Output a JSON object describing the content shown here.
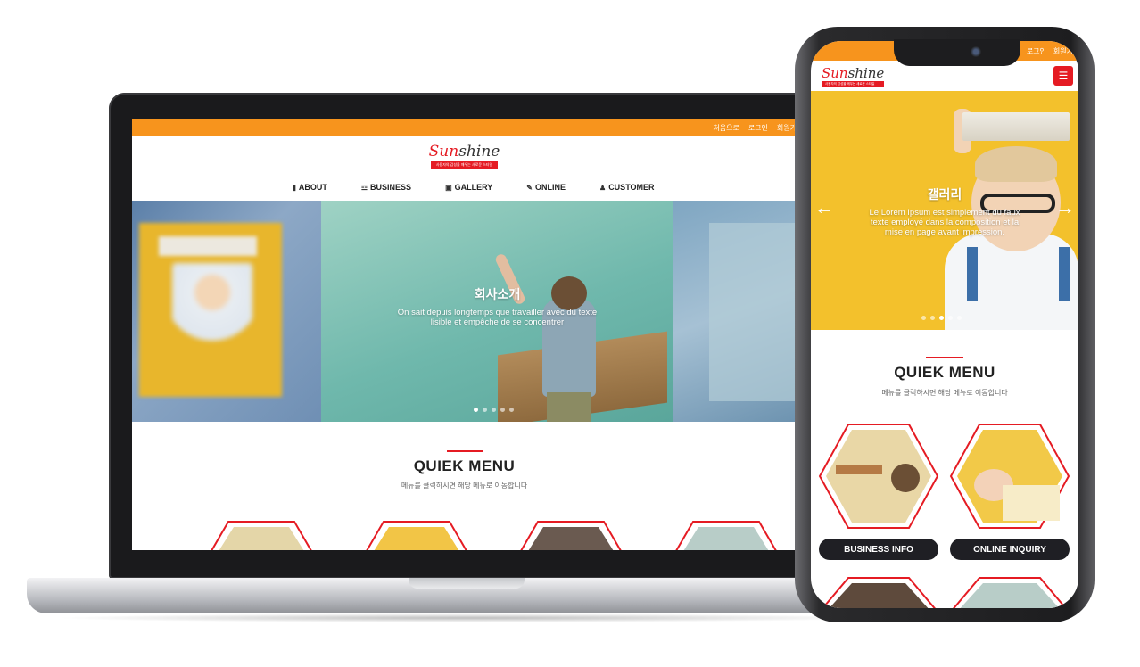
{
  "laptop": {
    "topbar": {
      "links": [
        "처음으로",
        "로그인",
        "회원가"
      ]
    },
    "logo": {
      "name_part1": "Sun",
      "name_part2": "shine",
      "tagline": "사용자의 감성을 깨우는 새로운 스타일"
    },
    "nav": [
      {
        "label": "ABOUT",
        "icon": "document-icon"
      },
      {
        "label": "BUSINESS",
        "icon": "sitemap-icon"
      },
      {
        "label": "GALLERY",
        "icon": "image-icon"
      },
      {
        "label": "ONLINE",
        "icon": "edit-icon"
      },
      {
        "label": "CUSTOMER",
        "icon": "users-icon"
      }
    ],
    "hero": {
      "title": "회사소개",
      "desc_line1": "On sait depuis longtemps que travailler avec du texte",
      "desc_line2": "lisible et empêche de se concentrer",
      "slide_count": 5,
      "active_slide": 1
    },
    "quick_menu": {
      "title": "QUIEK MENU",
      "subtitle": "메뉴를 클릭하시면 해당 메뉴로 이동합니다"
    }
  },
  "phone": {
    "topbar": {
      "links": [
        "로그인",
        "회원가"
      ]
    },
    "logo": {
      "name_part1": "Sun",
      "name_part2": "shine",
      "tagline": "사용자의 감성을 깨우는 새로운 스타일"
    },
    "menu_icon": "hamburger-icon",
    "hero": {
      "title": "갤러리",
      "desc_line1": "Le Lorem Ipsum est simplement du faux",
      "desc_line2": "texte employé dans la composition et la",
      "desc_line3": "mise en page avant impression.",
      "prev_icon": "arrow-left-icon",
      "next_icon": "arrow-right-icon",
      "slide_count": 5,
      "active_slide": 3
    },
    "quick_menu": {
      "title": "QUIEK MENU",
      "subtitle": "메뉴를 클릭하시면 해당 메뉴로 이동합니다",
      "buttons": [
        "BUSINESS INFO",
        "ONLINE INQUIRY"
      ]
    }
  },
  "colors": {
    "accent_orange": "#f7941d",
    "brand_red": "#e51b23",
    "dark_button": "#1f1f24"
  }
}
